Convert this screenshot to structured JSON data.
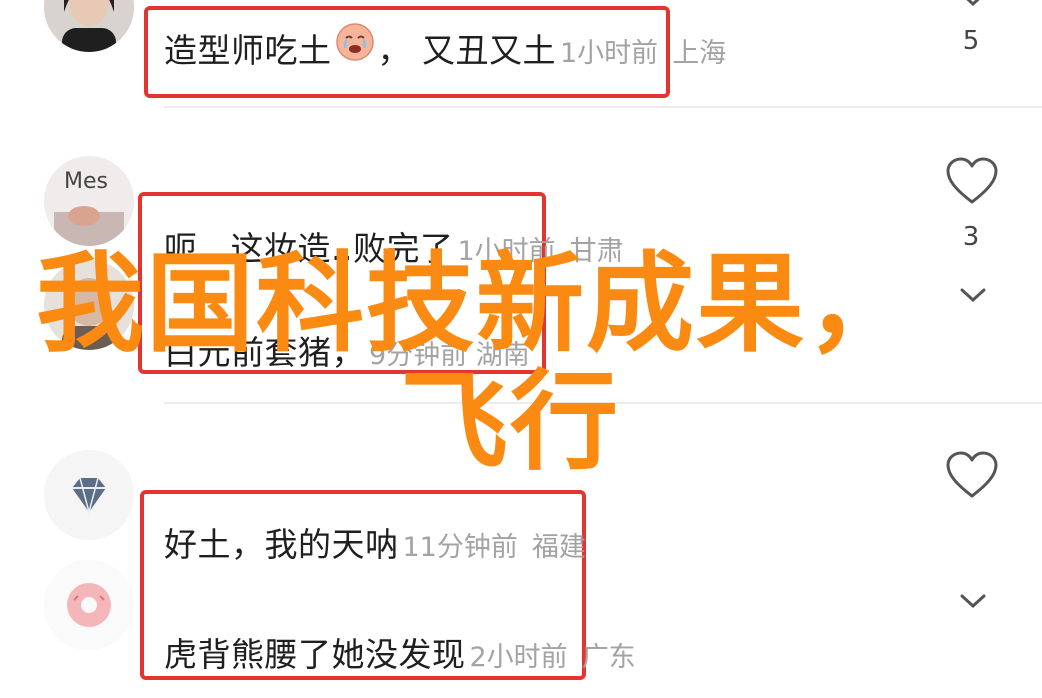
{
  "comments": [
    {
      "id": "c1",
      "text": "造型师吃土",
      "reaction_emoji": "crying-face-emoji",
      "reply": "，  又丑又土",
      "time": "1小时前",
      "location": "上海",
      "likes": "5"
    },
    {
      "id": "c2",
      "text": "呃...这妆造..败完了",
      "time": "1小时前",
      "location": "甘肃",
      "likes": "3",
      "partial_line": "白元前套猪，",
      "partial_meta": "9分钟前 湖南"
    },
    {
      "id": "c3",
      "text": "好土，我的天呐",
      "time": "11分钟前",
      "location": "福建"
    },
    {
      "id": "c4",
      "text": "虎背熊腰了她没发现",
      "time": "2小时前",
      "location": "广东"
    }
  ],
  "overlay": {
    "headline_line1": "我国科技新成果，",
    "headline_line2": "飞行",
    "color": "#fb8a12"
  },
  "accent": {
    "highlight_red": "#e3342f",
    "meta_gray": "#a3a3a3"
  },
  "icons": {
    "like": "heart-outline-icon",
    "expand": "chevron-down-icon"
  }
}
